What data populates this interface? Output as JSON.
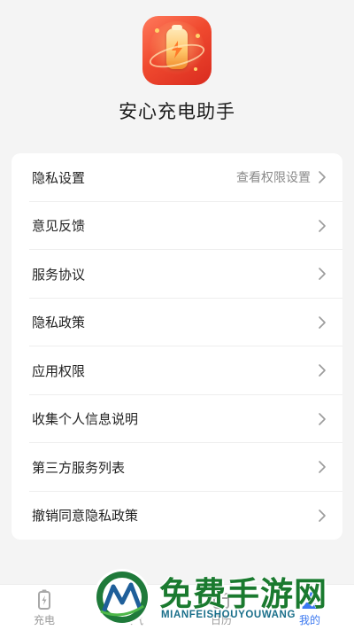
{
  "app": {
    "name": "安心充电助手"
  },
  "settings": {
    "items": [
      {
        "label": "隐私设置",
        "value": "查看权限设置"
      },
      {
        "label": "意见反馈"
      },
      {
        "label": "服务协议"
      },
      {
        "label": "隐私政策"
      },
      {
        "label": "应用权限"
      },
      {
        "label": "收集个人信息说明"
      },
      {
        "label": "第三方服务列表"
      },
      {
        "label": "撤销同意隐私政策"
      }
    ]
  },
  "tabbar": {
    "tabs": [
      {
        "label": "充电",
        "icon": "battery-charging-icon",
        "active": false
      },
      {
        "label": "天气",
        "icon": "weather-icon",
        "active": false
      },
      {
        "label": "日历",
        "icon": "calendar-icon",
        "active": false
      },
      {
        "label": "我的",
        "icon": "person-icon",
        "active": true
      }
    ]
  },
  "watermark": {
    "title": "免费手游网",
    "subtitle": "MIANFEISHOUYOUWANG"
  },
  "colors": {
    "accent": "#3b78f0",
    "background": "#f4f4f4",
    "card": "#ffffff",
    "watermark_green": "#1a7a2f"
  }
}
